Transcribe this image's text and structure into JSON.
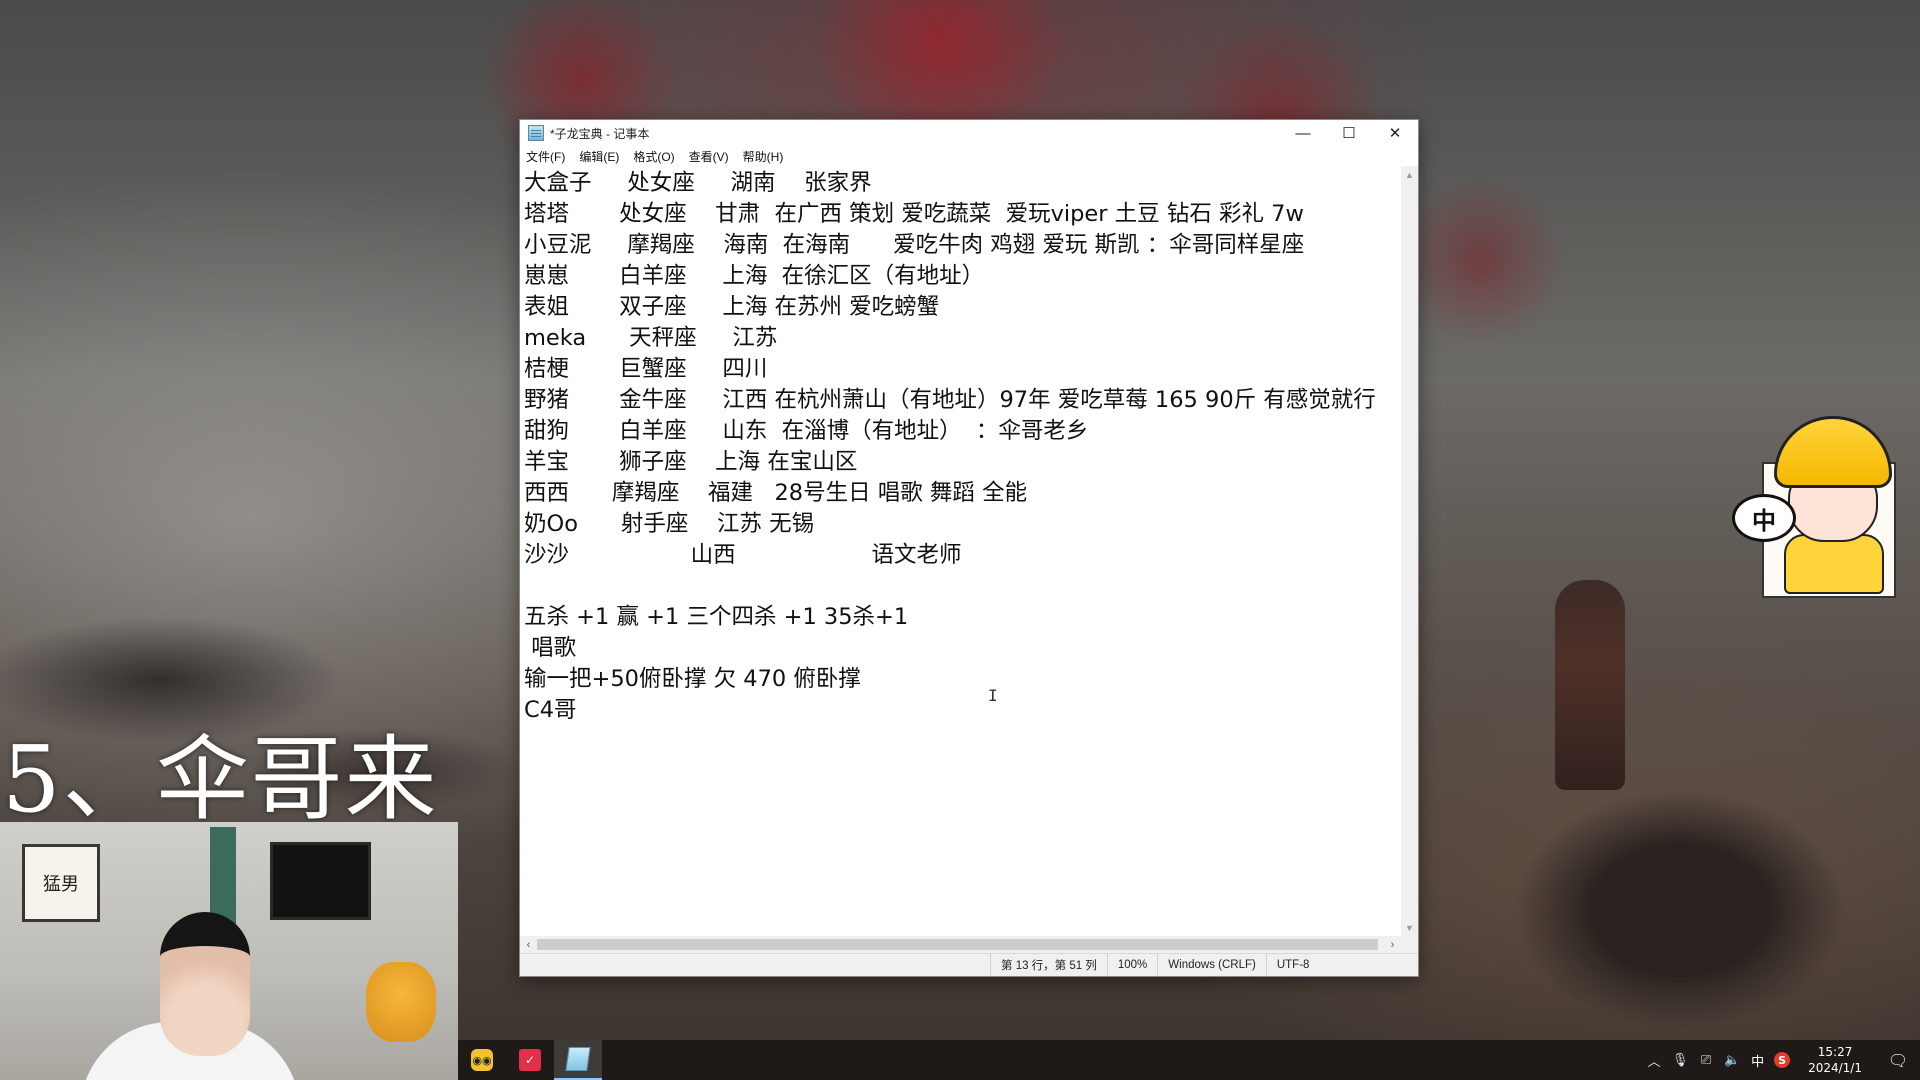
{
  "overlay": {
    "title": "5、伞哥来"
  },
  "webcam": {
    "frame_text": "猛男"
  },
  "notepad": {
    "window_title": "*子龙宝典 - 记事本",
    "minimize_glyph": "—",
    "maximize_glyph": "☐",
    "close_glyph": "✕",
    "menu": [
      "文件(F)",
      "编辑(E)",
      "格式(O)",
      "查看(V)",
      "帮助(H)"
    ],
    "content": "大盒子     处女座     湖南    张家界\n塔塔       处女座    甘肃  在广西 策划 爱吃蔬菜  爱玩viper 土豆 钻石 彩礼 7w\n小豆泥     摩羯座    海南  在海南      爱吃牛肉 鸡翅 爱玩 斯凯 ：伞哥同样星座\n崽崽       白羊座     上海  在徐汇区（有地址）\n表姐       双子座     上海 在苏州 爱吃螃蟹\nmeka      天秤座     江苏\n桔梗       巨蟹座     四川\n野猪       金牛座     江西 在杭州萧山（有地址）97年 爱吃草莓 165 90斤 有感觉就行\n甜狗       白羊座     山东  在淄博（有地址）  ：伞哥老乡\n羊宝       狮子座    上海 在宝山区\n西西      摩羯座    福建   28号生日 唱歌 舞蹈 全能\n奶Oo      射手座    江苏 无锡\n沙沙                 山西                   语文老师\n\n五杀 +1 赢 +1 三个四杀 +1 35杀+1\n 唱歌\n输一把+50俯卧撑 欠 470 俯卧撑\nC4哥",
    "ibeam_glyph": "I",
    "status": {
      "position": "第 13 行，第 51 列",
      "zoom": "100%",
      "line_ending": "Windows (CRLF)",
      "encoding": "UTF-8"
    }
  },
  "mascot": {
    "bubble_text": "中"
  },
  "taskbar": {
    "apps": [
      {
        "name": "owl-app",
        "active": false
      },
      {
        "name": "red-app",
        "active": false
      },
      {
        "name": "notepad-app",
        "active": true
      }
    ],
    "tray": {
      "ime": "中",
      "s_badge": "S",
      "time": "15:27",
      "date": "2024/1/1"
    }
  }
}
